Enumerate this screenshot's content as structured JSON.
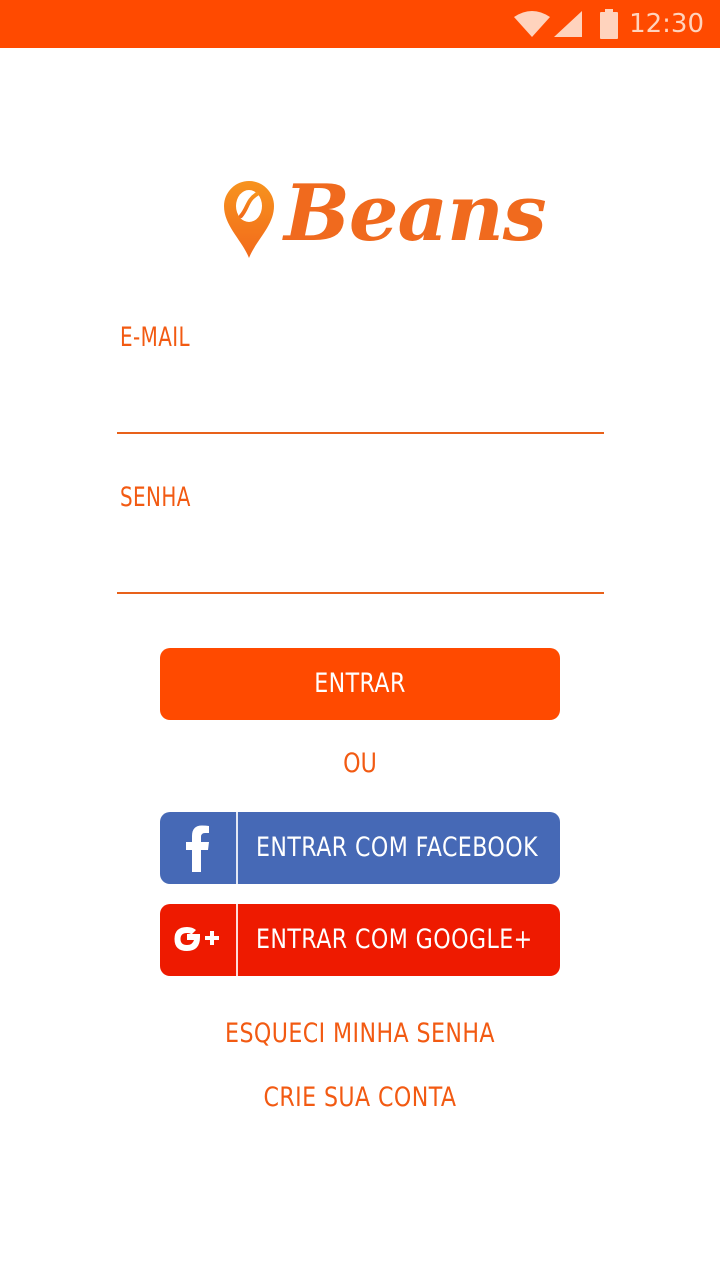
{
  "status_bar": {
    "time": "12:30",
    "icons": [
      "wifi-icon",
      "signal-icon",
      "battery-icon"
    ],
    "background": "#ff4a00"
  },
  "logo": {
    "text": "Beans",
    "icon": "map-pin-bean-icon"
  },
  "form": {
    "email": {
      "label": "E-MAIL",
      "value": "",
      "placeholder": ""
    },
    "password": {
      "label": "SENHA",
      "value": "",
      "placeholder": ""
    }
  },
  "buttons": {
    "login": "ENTRAR",
    "separator": "OU",
    "facebook": {
      "label": "ENTRAR COM FACEBOOK",
      "icon": "facebook-icon",
      "color": "#4669b6"
    },
    "google": {
      "label": "ENTRAR COM GOOGLE+",
      "icon": "google-plus-icon",
      "color": "#ee1a00"
    }
  },
  "links": {
    "forgot_password": "ESQUECI MINHA SENHA",
    "create_account": "CRIE SUA CONTA"
  },
  "colors": {
    "accent": "#ff4a00",
    "text_accent": "#f25a12"
  }
}
